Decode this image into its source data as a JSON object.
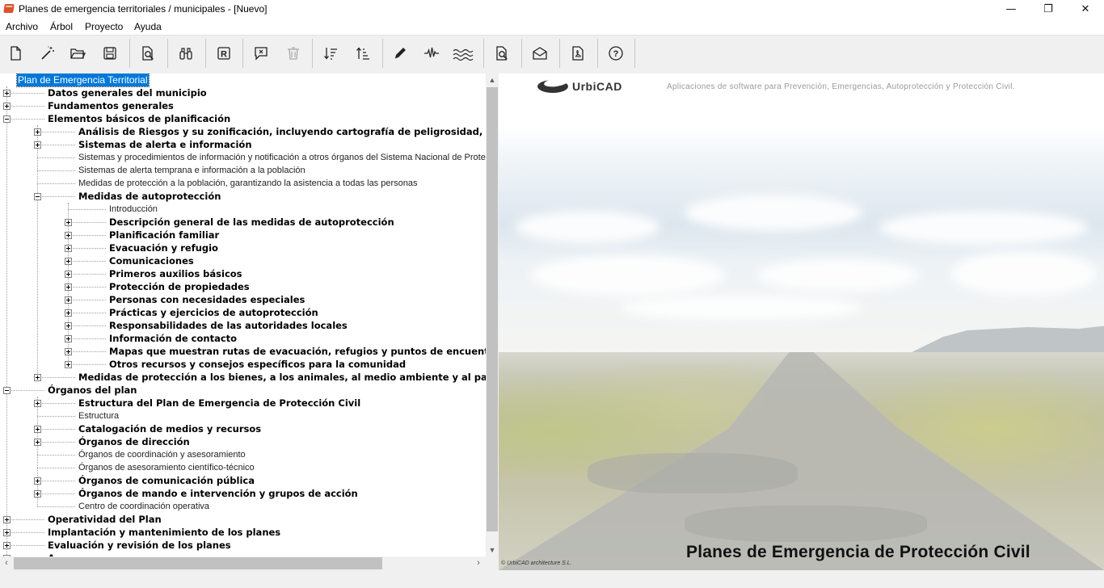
{
  "window": {
    "title": "Planes de emergencia territoriales / municipales - [Nuevo]",
    "controls": {
      "minimize": "—",
      "restore": "❐",
      "close": "✕"
    }
  },
  "menu": [
    "Archivo",
    "Árbol",
    "Proyecto",
    "Ayuda"
  ],
  "toolbar": {
    "buttons": [
      {
        "icon": "new-document-icon"
      },
      {
        "icon": "magic-wand-icon"
      },
      {
        "icon": "open-folder-icon"
      },
      {
        "icon": "save-icon"
      },
      {
        "icon": "print-preview-icon"
      },
      {
        "icon": "binoculars-icon"
      },
      {
        "icon": "r-box-icon",
        "text": "R"
      },
      {
        "icon": "comment-icon"
      },
      {
        "icon": "trash-icon"
      },
      {
        "icon": "sort-descending-icon"
      },
      {
        "icon": "sort-ascending-icon"
      },
      {
        "icon": "pencil-icon"
      },
      {
        "icon": "seismic-wave-icon"
      },
      {
        "icon": "water-waves-icon"
      },
      {
        "icon": "document-search-icon"
      },
      {
        "icon": "envelope-icon"
      },
      {
        "icon": "pdf-icon"
      },
      {
        "icon": "help-icon",
        "text": "?"
      }
    ]
  },
  "tree": {
    "nodes": [
      {
        "label": "Plan de Emergencia Territorial",
        "level": 0,
        "expander": "none",
        "style": "selected"
      },
      {
        "label": "Datos generales del municipio",
        "level": 1,
        "expander": "plus",
        "style": "bold"
      },
      {
        "label": "Fundamentos generales",
        "level": 1,
        "expander": "plus",
        "style": "bold"
      },
      {
        "label": "Elementos básicos de planificación",
        "level": 1,
        "expander": "minus",
        "style": "bold"
      },
      {
        "label": "Análisis de Riesgos y su zonificación, incluyendo cartografía de peligrosidad, vulnerabilidad",
        "level": 2,
        "expander": "plus",
        "style": "bold"
      },
      {
        "label": "Sistemas de alerta e información",
        "level": 2,
        "expander": "plus",
        "style": "bold"
      },
      {
        "label": "Sistemas y procedimientos de información y notificación a otros órganos del Sistema Nacional de Protección",
        "level": 2,
        "expander": "none",
        "style": "normal"
      },
      {
        "label": "Sistemas de alerta temprana e información a la población",
        "level": 2,
        "expander": "none",
        "style": "normal"
      },
      {
        "label": "Medidas de protección a la población, garantizando la asistencia a todas las personas",
        "level": 2,
        "expander": "none",
        "style": "normal"
      },
      {
        "label": "Medidas de autoprotección",
        "level": 2,
        "expander": "minus",
        "style": "bold"
      },
      {
        "label": "Introducción",
        "level": 3,
        "expander": "none",
        "style": "normal"
      },
      {
        "label": "Descripción general de las medidas de autoprotección",
        "level": 3,
        "expander": "plus",
        "style": "bold"
      },
      {
        "label": "Planificación familiar",
        "level": 3,
        "expander": "plus",
        "style": "bold"
      },
      {
        "label": "Evacuación y refugio",
        "level": 3,
        "expander": "plus",
        "style": "bold"
      },
      {
        "label": "Comunicaciones",
        "level": 3,
        "expander": "plus",
        "style": "bold"
      },
      {
        "label": "Primeros auxilios básicos",
        "level": 3,
        "expander": "plus",
        "style": "bold"
      },
      {
        "label": "Protección de propiedades",
        "level": 3,
        "expander": "plus",
        "style": "bold"
      },
      {
        "label": "Personas con necesidades especiales",
        "level": 3,
        "expander": "plus",
        "style": "bold"
      },
      {
        "label": "Prácticas y ejercicios de autoprotección",
        "level": 3,
        "expander": "plus",
        "style": "bold"
      },
      {
        "label": "Responsabilidades de las autoridades locales",
        "level": 3,
        "expander": "plus",
        "style": "bold"
      },
      {
        "label": "Información de contacto",
        "level": 3,
        "expander": "plus",
        "style": "bold"
      },
      {
        "label": "Mapas que muestran rutas de evacuación, refugios y puntos de encuentro",
        "level": 3,
        "expander": "plus",
        "style": "bold"
      },
      {
        "label": "Otros recursos y consejos específicos para la comunidad",
        "level": 3,
        "expander": "plus",
        "style": "bold"
      },
      {
        "label": "Medidas de protección a los bienes, a los animales, al medio ambiente y al patrimonio histórico",
        "level": 2,
        "expander": "plus",
        "style": "bold"
      },
      {
        "label": "Órganos del plan",
        "level": 1,
        "expander": "minus",
        "style": "bold"
      },
      {
        "label": "Estructura del Plan de Emergencia de Protección Civil",
        "level": 2,
        "expander": "plus",
        "style": "bold"
      },
      {
        "label": "Estructura",
        "level": 2,
        "expander": "none",
        "style": "normal"
      },
      {
        "label": "Catalogación de medios y recursos",
        "level": 2,
        "expander": "plus",
        "style": "bold"
      },
      {
        "label": "Órganos de dirección",
        "level": 2,
        "expander": "plus",
        "style": "bold"
      },
      {
        "label": "Órganos de coordinación y asesoramiento",
        "level": 2,
        "expander": "none",
        "style": "normal"
      },
      {
        "label": "Órganos de asesoramiento científico-técnico",
        "level": 2,
        "expander": "none",
        "style": "normal"
      },
      {
        "label": "Órganos de comunicación pública",
        "level": 2,
        "expander": "plus",
        "style": "bold"
      },
      {
        "label": "Órganos de mando e intervención y grupos de acción",
        "level": 2,
        "expander": "plus",
        "style": "bold"
      },
      {
        "label": "Centro de coordinación operativa",
        "level": 2,
        "expander": "none",
        "style": "normal"
      },
      {
        "label": "Operatividad del Plan",
        "level": 1,
        "expander": "plus",
        "style": "bold"
      },
      {
        "label": "Implantación y mantenimiento de los planes",
        "level": 1,
        "expander": "plus",
        "style": "bold"
      },
      {
        "label": "Evaluación y revisión de los planes",
        "level": 1,
        "expander": "plus",
        "style": "bold"
      },
      {
        "label": "A",
        "level": 1,
        "expander": "plus",
        "style": "bold"
      }
    ]
  },
  "scrollbars": {
    "up_arrow": "▲",
    "down_arrow": "▼",
    "left_arrow": "‹",
    "right_arrow": "›"
  },
  "splash": {
    "logo": "UrbiCAD",
    "tagline": "Aplicaciones de software para Prevención, Emergencias, Autoprotección y Protección Civil.",
    "banner": "Planes de Emergencia de Protección Civil",
    "copyright": "© UrbiCAD architecture S.L."
  },
  "colors": {
    "selection": "#0078d7",
    "tree_background": "#ffffff",
    "chrome_background": "#f0f0f0"
  }
}
